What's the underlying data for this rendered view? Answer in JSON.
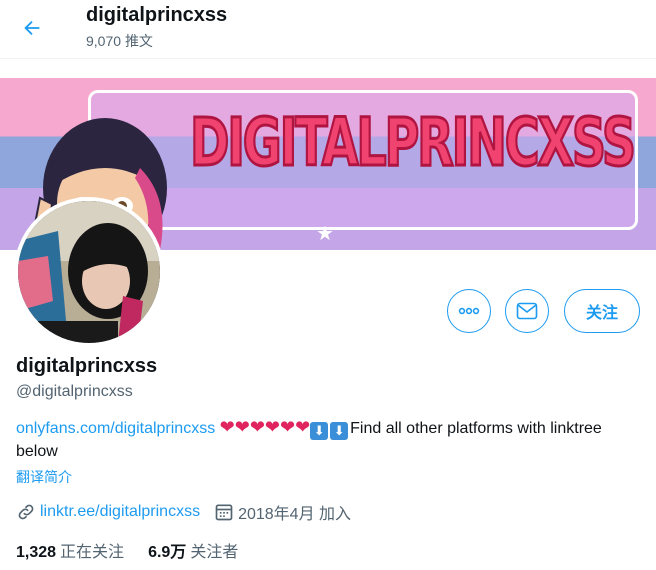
{
  "header": {
    "title": "digitalprincxss",
    "tweet_count": "9,070",
    "tweets_label": "推文",
    "back_icon": "arrow-left-icon"
  },
  "banner": {
    "text": "DIGITALPRINCXSS",
    "colors": {
      "pink": "#f6a8cf",
      "blue": "#8fa6dd",
      "lavender": "#c4a6e8",
      "text": "#f0436f"
    }
  },
  "profile": {
    "name": "digitalprincxss",
    "handle": "@digitalprincxss",
    "bio_link": "onlyfans.com/digitalprincxss",
    "bio_emoji_hearts": "❤❤❤❤❤❤",
    "bio_text": "Find all other platforms with linktree below",
    "translate_label": "翻译简介",
    "website": "linktr.ee/digitalprincxss",
    "joined": "2018年4月 加入",
    "following_count": "1,328",
    "following_label": "正在关注",
    "followers_count": "6.9万",
    "followers_label": "关注者"
  },
  "actions": {
    "follow_label": "关注",
    "more_icon": "more-icon",
    "message_icon": "mail-icon"
  },
  "accent": "#1d9bf0"
}
